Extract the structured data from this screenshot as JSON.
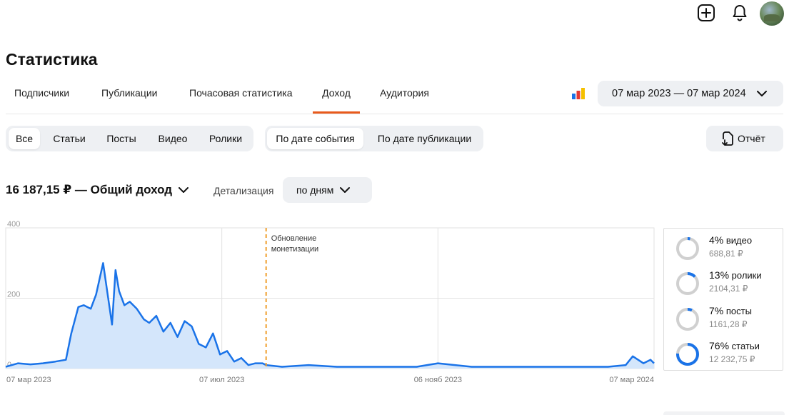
{
  "topbar": {
    "icons": [
      "plus-square-icon",
      "bell-icon"
    ]
  },
  "page": {
    "title": "Статистика"
  },
  "tabs": [
    {
      "label": "Подписчики",
      "active": false
    },
    {
      "label": "Публикации",
      "active": false
    },
    {
      "label": "Почасовая статистика",
      "active": false
    },
    {
      "label": "Доход",
      "active": true
    },
    {
      "label": "Аудитория",
      "active": false
    }
  ],
  "date_range": {
    "label": "07 мар 2023 — 07 мар 2024"
  },
  "content_filter": [
    "Все",
    "Статьи",
    "Посты",
    "Видео",
    "Ролики"
  ],
  "date_mode": [
    "По дате события",
    "По дате публикации"
  ],
  "report_button": {
    "label": "Отчёт"
  },
  "summary": {
    "total": "16 187,15 ₽ — Общий доход",
    "detail_label": "Детализация",
    "detail_value": "по дням"
  },
  "chart_data": {
    "type": "area",
    "ylim": [
      0,
      400
    ],
    "yticks": [
      "400",
      "200",
      "0"
    ],
    "xticks": [
      "07 мар 2023",
      "07 июл 2023",
      "06 нояб 2023",
      "07 мар 2024"
    ],
    "annotation": {
      "text_line1": "Обновление",
      "text_line2": "монетизации",
      "date": "2023-08-01"
    },
    "series": [
      {
        "x": [
          "2023-03-07",
          "2023-03-14",
          "2023-03-21",
          "2023-03-28",
          "2023-04-04",
          "2023-04-10",
          "2023-04-13",
          "2023-04-17",
          "2023-04-20",
          "2023-04-24",
          "2023-04-27",
          "2023-05-01",
          "2023-05-04",
          "2023-05-06",
          "2023-05-08",
          "2023-05-10",
          "2023-05-13",
          "2023-05-16",
          "2023-05-20",
          "2023-05-24",
          "2023-05-27",
          "2023-05-31",
          "2023-06-04",
          "2023-06-08",
          "2023-06-12",
          "2023-06-16",
          "2023-06-20",
          "2023-06-24",
          "2023-06-28",
          "2023-07-02",
          "2023-07-06",
          "2023-07-10",
          "2023-07-14",
          "2023-07-18",
          "2023-07-22",
          "2023-07-26",
          "2023-07-30",
          "2023-08-01",
          "2023-08-10",
          "2023-08-25",
          "2023-09-10",
          "2023-09-25",
          "2023-10-10",
          "2023-10-25",
          "2023-11-06",
          "2023-11-25",
          "2023-12-10",
          "2023-12-25",
          "2024-01-10",
          "2024-01-25",
          "2024-02-10",
          "2024-02-20",
          "2024-02-24",
          "2024-03-01",
          "2024-03-05",
          "2024-03-07"
        ],
        "values": [
          5,
          15,
          12,
          15,
          20,
          25,
          100,
          175,
          180,
          170,
          210,
          300,
          195,
          125,
          280,
          220,
          180,
          190,
          170,
          140,
          130,
          150,
          105,
          130,
          90,
          135,
          120,
          70,
          60,
          100,
          40,
          50,
          20,
          30,
          10,
          15,
          15,
          10,
          5,
          10,
          5,
          5,
          5,
          5,
          15,
          5,
          5,
          5,
          5,
          5,
          5,
          10,
          35,
          15,
          25,
          15
        ]
      }
    ]
  },
  "legend": [
    {
      "pct": "4%",
      "label": "видео",
      "amount": "688,81 ₽",
      "fraction": 0.04
    },
    {
      "pct": "13%",
      "label": "ролики",
      "amount": "2104,31 ₽",
      "fraction": 0.13
    },
    {
      "pct": "7%",
      "label": "посты",
      "amount": "1161,28 ₽",
      "fraction": 0.07
    },
    {
      "pct": "76%",
      "label": "статьи",
      "amount": "12 232,75 ₽",
      "fraction": 0.76
    }
  ],
  "colors": {
    "accent": "#e85a1c",
    "series": "#1a73e8",
    "fill": "#d4e6fb",
    "annotation": "#f0a030"
  }
}
